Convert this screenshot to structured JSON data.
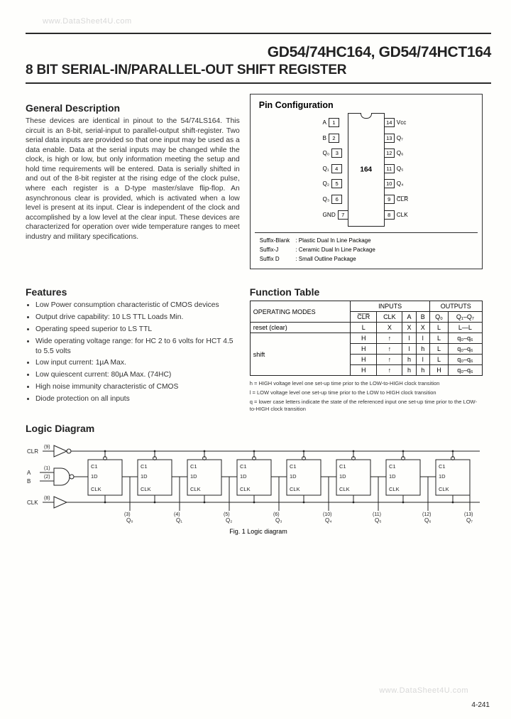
{
  "watermark_top": "www.DataSheet4U.com",
  "watermark_bottom": "www.DataSheet4U.com",
  "title": "GD54/74HC164, GD54/74HCT164",
  "subtitle": "8 BIT SERIAL-IN/PARALLEL-OUT SHIFT REGISTER",
  "gen_desc_h": "General Description",
  "gen_desc": "These devices are identical in pinout to the 54/74LS164. This circuit is an 8-bit, serial-input to parallel-output shift-register. Two serial data inputs are provided so that one input may be used as a data enable. Data at the serial inputs may be changed while the clock, is high or low, but only information meeting the setup and hold time requirements will be entered. Data is serially shifted in and out of the 8-bit register at the rising edge of the clock pulse, where each register is a D-type master/slave flip-flop. An asynchronous clear is provided, which is activated when a low level is present at its input. Clear is independent of the clock and accomplished by a low level at the clear input. These devices are characterized for operation over wide temperature ranges to meet industry and military specifications.",
  "pin_h": "Pin Configuration",
  "chip_label": "164",
  "pins_left": [
    {
      "num": "1",
      "name": "A"
    },
    {
      "num": "2",
      "name": "B"
    },
    {
      "num": "3",
      "name": "Q₀"
    },
    {
      "num": "4",
      "name": "Q₁"
    },
    {
      "num": "5",
      "name": "Q₂"
    },
    {
      "num": "6",
      "name": "Q₃"
    },
    {
      "num": "7",
      "name": "GND"
    }
  ],
  "pins_right": [
    {
      "num": "14",
      "name": "Vcc"
    },
    {
      "num": "13",
      "name": "Q₇"
    },
    {
      "num": "12",
      "name": "Q₆"
    },
    {
      "num": "11",
      "name": "Q₅"
    },
    {
      "num": "10",
      "name": "Q₄"
    },
    {
      "num": "9",
      "name": "C̅L̅R̅"
    },
    {
      "num": "8",
      "name": "CLK"
    }
  ],
  "suffix": [
    [
      "Suffix-Blank",
      ": Plastic Dual In Line Package"
    ],
    [
      "Suffix-J",
      ": Ceramic Dual In Line Package"
    ],
    [
      "Suffix D",
      ": Small Outline Package"
    ]
  ],
  "features_h": "Features",
  "features": [
    "Low Power consumption characteristic of CMOS devices",
    "Output drive capability: 10 LS TTL Loads Min.",
    "Operating speed superior to LS TTL",
    "Wide operating voltage range: for HC 2 to 6 volts for HCT 4.5 to 5.5 volts",
    "Low input current: 1µA Max.",
    "Low quiescent current: 80µA Max. (74HC)",
    "High noise immunity characteristic of CMOS",
    "Diode protection on all inputs"
  ],
  "ft_h": "Function Table",
  "ft": {
    "head1": [
      "OPERATING MODES",
      "INPUTS",
      "OUTPUTS"
    ],
    "head2": [
      "C̅L̅R̅",
      "CLK",
      "A",
      "B",
      "Q₀",
      "Q₁–Q₇"
    ],
    "rows": [
      [
        "reset (clear)",
        "L",
        "X",
        "X",
        "X",
        "L",
        "L—L"
      ],
      [
        "shift",
        "H",
        "↑",
        "l",
        "l",
        "L",
        "q₀–q₆"
      ],
      [
        "",
        "H",
        "↑",
        "l",
        "h",
        "L",
        "q₀–q₆"
      ],
      [
        "",
        "H",
        "↑",
        "h",
        "l",
        "L",
        "q₀–q₆"
      ],
      [
        "",
        "H",
        "↑",
        "h",
        "h",
        "H",
        "q₀–q₆"
      ]
    ]
  },
  "notes": [
    "h = HIGH voltage level one set-up time prior to the LOW-to-HIGH clock transition",
    "l = LOW voltage level one set-up time prior to the LOW to HIGH clock transition",
    "q = lower case letters indicate the state of the referenced input one set-up time prior to the LOW-to-HIGH clock transition"
  ],
  "logic_h": "Logic Diagram",
  "logic_caption": "Fig. 1 Logic diagram",
  "logic": {
    "inputs": [
      "CLR",
      "A",
      "B",
      "CLK"
    ],
    "input_pins": [
      "(9)",
      "(1)",
      "(2)",
      "(8)"
    ],
    "ff_labels": [
      "C1",
      "1D",
      "CLK"
    ],
    "outputs": [
      "Q₀",
      "Q₁",
      "Q₂",
      "Q₃",
      "Q₄",
      "Q₅",
      "Q₆",
      "Q₇"
    ],
    "output_pins": [
      "(3)",
      "(4)",
      "(5)",
      "(6)",
      "(10)",
      "(11)",
      "(12)",
      "(13)"
    ]
  },
  "page_num": "4-241"
}
